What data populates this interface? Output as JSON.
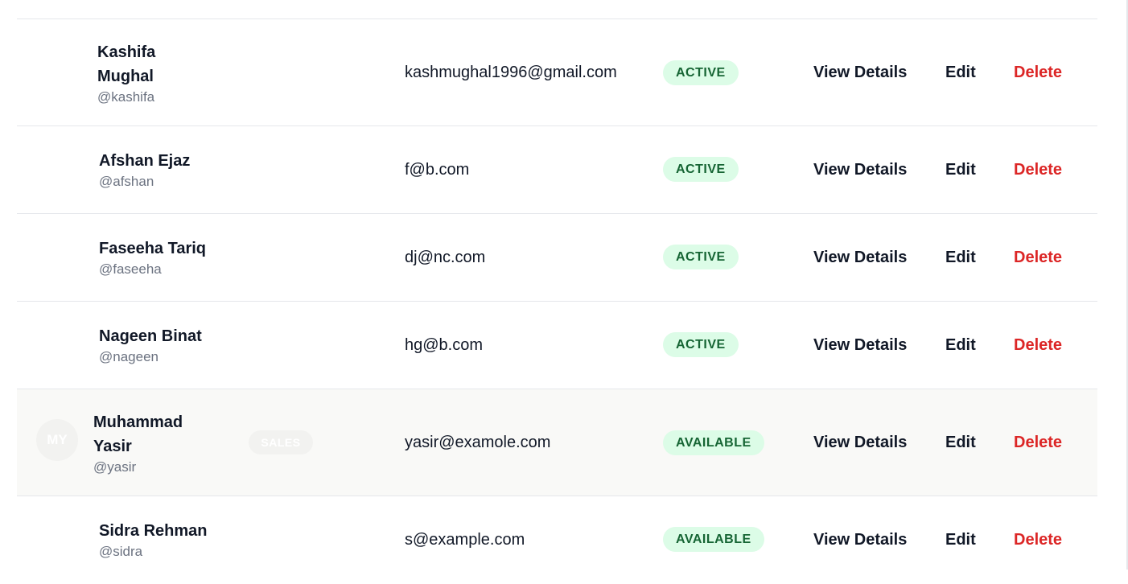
{
  "actions": {
    "view": "View Details",
    "edit": "Edit",
    "delete": "Delete"
  },
  "rows": [
    {
      "name": "Kashifa Mughal",
      "handle": "@kashifa",
      "email": "kashmughal1996@gmail.com",
      "status": "ACTIVE"
    },
    {
      "name": "Afshan Ejaz",
      "handle": "@afshan",
      "email": "f@b.com",
      "status": "ACTIVE"
    },
    {
      "name": "Faseeha Tariq",
      "handle": "@faseeha",
      "email": "dj@nc.com",
      "status": "ACTIVE"
    },
    {
      "name": "Nageen Binat",
      "handle": "@nageen",
      "email": "hg@b.com",
      "status": "ACTIVE"
    },
    {
      "name": "Muhammad Yasir",
      "handle": "@yasir",
      "email": "yasir@examole.com",
      "status": "AVAILABLE",
      "initials": "MY",
      "role": "SALES"
    },
    {
      "name": "Sidra Rehman",
      "handle": "@sidra",
      "email": "s@example.com",
      "status": "AVAILABLE"
    }
  ],
  "colors": {
    "status_bg": "#dcfce7",
    "status_text": "#166534",
    "delete": "#dc2626",
    "hover_row": "#f9f9f7"
  }
}
